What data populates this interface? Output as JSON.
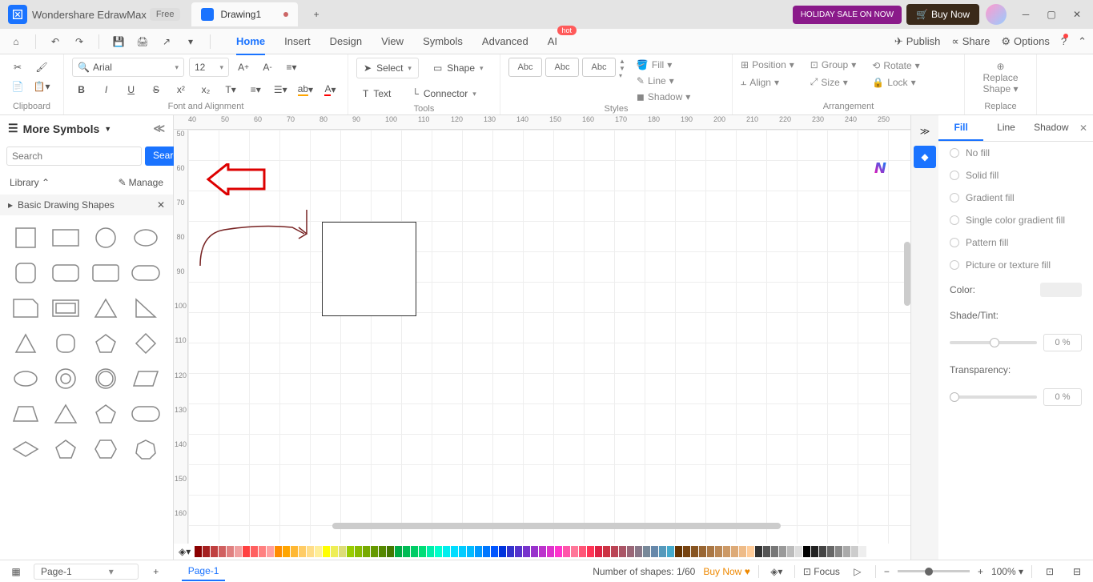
{
  "titlebar": {
    "app_name": "Wondershare EdrawMax",
    "free_badge": "Free",
    "tab_name": "Drawing1",
    "holiday": "HOLIDAY SALE ON NOW",
    "buy_now": "Buy Now"
  },
  "menu": {
    "tabs": [
      "Home",
      "Insert",
      "Design",
      "View",
      "Symbols",
      "Advanced",
      "AI"
    ],
    "hot": "hot",
    "publish": "Publish",
    "share": "Share",
    "options": "Options"
  },
  "ribbon": {
    "clipboard": "Clipboard",
    "font_alignment": "Font and Alignment",
    "font_name": "Arial",
    "font_size": "12",
    "tools": "Tools",
    "select": "Select",
    "shape": "Shape",
    "text": "Text",
    "connector": "Connector",
    "styles": "Styles",
    "style_label": "Abc",
    "fill": "Fill",
    "line": "Line",
    "shadow": "Shadow",
    "arrangement": "Arrangement",
    "position": "Position",
    "align": "Align",
    "group": "Group",
    "size": "Size",
    "rotate": "Rotate",
    "lock": "Lock",
    "replace_shape": "Replace\nShape",
    "replace": "Replace"
  },
  "left_panel": {
    "more_symbols": "More Symbols",
    "search_placeholder": "Search",
    "search_btn": "Search",
    "library": "Library",
    "manage": "Manage",
    "shapes_title": "Basic Drawing Shapes"
  },
  "ruler_h": [
    "40",
    "50",
    "60",
    "70",
    "80",
    "90",
    "100",
    "110",
    "120",
    "130",
    "140",
    "150",
    "160",
    "170",
    "180",
    "190",
    "200",
    "210",
    "220",
    "230",
    "240",
    "250"
  ],
  "ruler_v": [
    "50",
    "60",
    "70",
    "80",
    "90",
    "100",
    "110",
    "120",
    "130",
    "140",
    "150",
    "160"
  ],
  "right_panel": {
    "tabs": [
      "Fill",
      "Line",
      "Shadow"
    ],
    "no_fill": "No fill",
    "solid_fill": "Solid fill",
    "gradient_fill": "Gradient fill",
    "single_gradient": "Single color gradient fill",
    "pattern_fill": "Pattern fill",
    "picture_fill": "Picture or texture fill",
    "color": "Color:",
    "shade_tint": "Shade/Tint:",
    "transparency": "Transparency:",
    "pct": "0 %"
  },
  "statusbar": {
    "page": "Page-1",
    "page_tab": "Page-1",
    "shapes": "Number of shapes: 1/60",
    "buy_now": "Buy Now",
    "focus": "Focus",
    "zoom": "100%"
  },
  "colors": [
    "#8b0000",
    "#a52020",
    "#c04040",
    "#d06060",
    "#e08080",
    "#f0a0a0",
    "#ff4040",
    "#ff6060",
    "#ff8080",
    "#ffa0a0",
    "#ff8c00",
    "#ffa500",
    "#ffb833",
    "#ffcc66",
    "#ffdd88",
    "#ffee99",
    "#ffff00",
    "#eeee55",
    "#dddd77",
    "#99cc00",
    "#88bb00",
    "#77aa00",
    "#669900",
    "#558800",
    "#447700",
    "#00aa44",
    "#00bb55",
    "#00cc66",
    "#00dd77",
    "#00eeaa",
    "#00ffcc",
    "#00eeee",
    "#00ddff",
    "#00ccff",
    "#00bbff",
    "#0099ff",
    "#0077ff",
    "#0055ff",
    "#0033dd",
    "#3333cc",
    "#5533cc",
    "#7733cc",
    "#9933cc",
    "#bb33cc",
    "#dd33cc",
    "#ff33cc",
    "#ff55aa",
    "#ff7799",
    "#ff5577",
    "#ff3355",
    "#dd2244",
    "#cc3344",
    "#bb4455",
    "#aa5566",
    "#996677",
    "#887788",
    "#778899",
    "#6688aa",
    "#5599bb",
    "#44aacc",
    "#663300",
    "#774411",
    "#885522",
    "#996633",
    "#aa7744",
    "#bb8855",
    "#cc9966",
    "#ddaa77",
    "#eebb88",
    "#ffcc99",
    "#333333",
    "#555555",
    "#777777",
    "#999999",
    "#bbbbbb",
    "#dddddd",
    "#000000",
    "#222222",
    "#444444",
    "#666666",
    "#888888",
    "#aaaaaa",
    "#cccccc",
    "#eeeeee"
  ]
}
